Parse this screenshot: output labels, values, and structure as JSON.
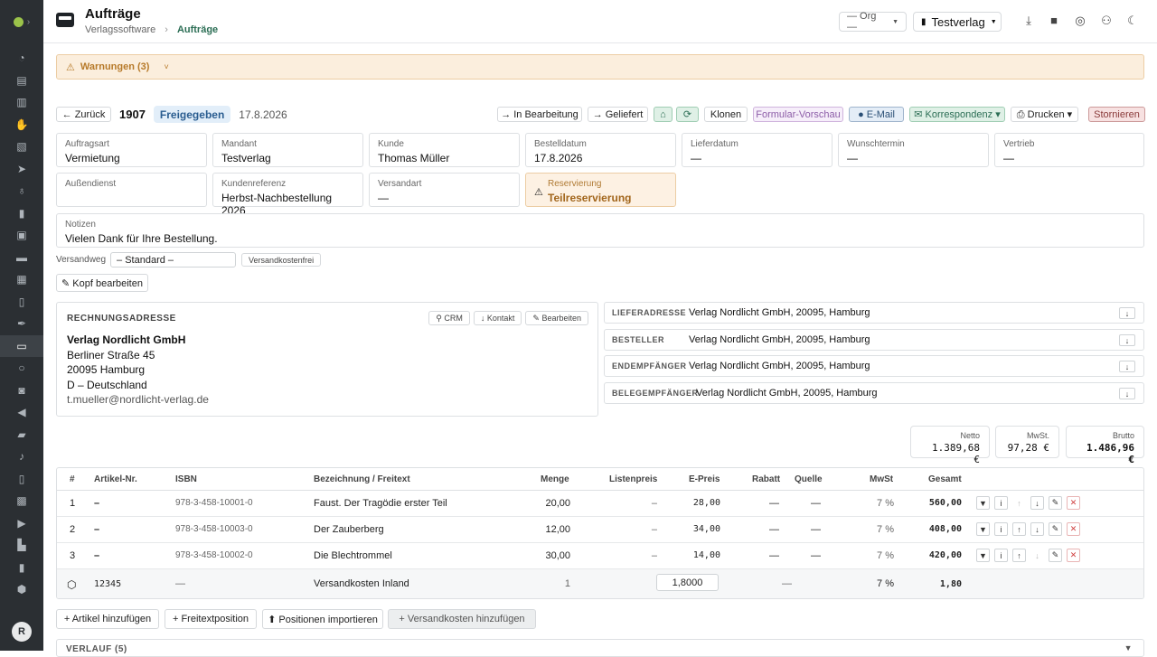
{
  "app": {
    "title": "Aufträge",
    "breadcrumb": [
      "Verlagssoftware",
      "Aufträge"
    ]
  },
  "header": {
    "org_select": "— Org —",
    "verlag_select": "Testverlag"
  },
  "rail": {
    "avatar": "R",
    "icons": [
      "dashboard-icon",
      "calendar-icon",
      "kanban-icon",
      "hand-icon",
      "stack-icon",
      "send-icon",
      "bulb-icon",
      "library-icon",
      "image-icon",
      "briefcase-icon",
      "news-icon",
      "receipt-icon",
      "feather-icon",
      "orders-icon",
      "circle-icon",
      "bag-icon",
      "megaphone-icon",
      "car-icon",
      "music-icon",
      "document-icon",
      "boxes-icon",
      "truck-icon",
      "stats-icon",
      "invoice-icon",
      "shield-icon"
    ]
  },
  "warnings": {
    "label": "Warnungen (3)"
  },
  "order": {
    "back": "← Zurück",
    "number": "1907",
    "status": "Freigegeben",
    "date": "17.8.2026",
    "actions": [
      "→ In Bearbeitung",
      "→ Geliefert",
      "⌂",
      "⟳",
      "Klonen",
      "Formular-Vorschau",
      "● E-Mail",
      "✉ Korrespondenz ▾",
      "⎙ Drucken ▾",
      "Stornieren"
    ],
    "fields": [
      {
        "label": "Auftragsart",
        "value": "Vermietung"
      },
      {
        "label": "Mandant",
        "value": "Testverlag"
      },
      {
        "label": "Kunde",
        "value": "Thomas Müller"
      },
      {
        "label": "Bestelldatum",
        "value": "17.8.2026"
      },
      {
        "label": "Lieferdatum",
        "value": "—"
      },
      {
        "label": "Wunschtermin",
        "value": "—"
      },
      {
        "label": "Vertrieb",
        "value": "—"
      },
      {
        "label": "Außendienst",
        "value": ""
      },
      {
        "label": "Kundenreferenz",
        "value": "Herbst-Nachbestellung 2026"
      },
      {
        "label": "Versandart",
        "value": "—"
      },
      {
        "label": "Reservierung",
        "value": "Teilreservierung"
      }
    ],
    "notes_label": "Notizen",
    "notes": "Vielen Dank für Ihre Bestellung.",
    "versandweg_label": "Versandweg",
    "versandweg": "– Standard –",
    "versandkostenfrei": "Versandkostenfrei",
    "edit_head": "✎ Kopf bearbeiten"
  },
  "billing": {
    "title": "RECHNUNGSADRESSE",
    "crm": "⚲ CRM",
    "kontakt": "↓ Kontakt",
    "bearbeiten": "✎ Bearbeiten",
    "name": "Verlag Nordlicht GmbH",
    "street": "Berliner Straße 45",
    "city": "20095 Hamburg",
    "country": "D – Deutschland",
    "email": "t.mueller@nordlicht-verlag.de"
  },
  "addresses": [
    {
      "label": "LIEFERADRESSE",
      "value": "Verlag Nordlicht GmbH, 20095, Hamburg"
    },
    {
      "label": "BESTELLER",
      "value": "Verlag Nordlicht GmbH, 20095, Hamburg"
    },
    {
      "label": "ENDEMPFÄNGER",
      "value": "Verlag Nordlicht GmbH, 20095, Hamburg"
    },
    {
      "label": "BELEGEMPFÄNGER",
      "value": "Verlag Nordlicht GmbH, 20095, Hamburg"
    }
  ],
  "totals": {
    "netto_label": "Netto",
    "netto": "1.389,68 €",
    "mwst_label": "MwSt.",
    "mwst": "97,28 €",
    "brutto_label": "Brutto",
    "brutto": "1.486,96 €"
  },
  "table": {
    "headers": [
      "#",
      "Artikel-Nr.",
      "ISBN",
      "Bezeichnung / Freitext",
      "Menge",
      "Listenpreis",
      "E-Preis",
      "Rabatt",
      "Quelle",
      "MwSt",
      "Gesamt"
    ],
    "rows": [
      {
        "pos": "1",
        "art": "–",
        "isbn": "978-3-458-10001-0",
        "name": "Faust. Der Tragödie erster Teil",
        "menge": "20,00",
        "liste": "–",
        "epreis": "28,00",
        "rabatt": "—",
        "quelle": "—",
        "mwst": "7 %",
        "gesamt": "560,00"
      },
      {
        "pos": "2",
        "art": "–",
        "isbn": "978-3-458-10003-0",
        "name": "Der Zauberberg",
        "menge": "12,00",
        "liste": "–",
        "epreis": "34,00",
        "rabatt": "—",
        "quelle": "—",
        "mwst": "7 %",
        "gesamt": "408,00"
      },
      {
        "pos": "3",
        "art": "–",
        "isbn": "978-3-458-10002-0",
        "name": "Die Blechtrommel",
        "menge": "30,00",
        "liste": "–",
        "epreis": "14,00",
        "rabatt": "—",
        "quelle": "—",
        "mwst": "7 %",
        "gesamt": "420,00"
      }
    ],
    "shipping": {
      "art": "12345",
      "isbn": "—",
      "name": "Versandkosten Inland",
      "menge": "1",
      "epreis": "1,8000",
      "rabatt": "—",
      "mwst": "7 %",
      "gesamt": "1,80"
    }
  },
  "bottom": {
    "add_article": "+ Artikel hinzufügen",
    "add_free": "+ Freitextposition",
    "import": "⬆ Positionen importieren",
    "add_shipping": "+ Versandkosten hinzufügen"
  },
  "history": {
    "label": "VERLAUF (5)"
  },
  "colors": {
    "rail": "#2b2f33",
    "accent": "#2c6e55",
    "warning_bg": "#fbeedd",
    "warning_text": "#b77a2a",
    "status_bg": "#e2eef9"
  }
}
